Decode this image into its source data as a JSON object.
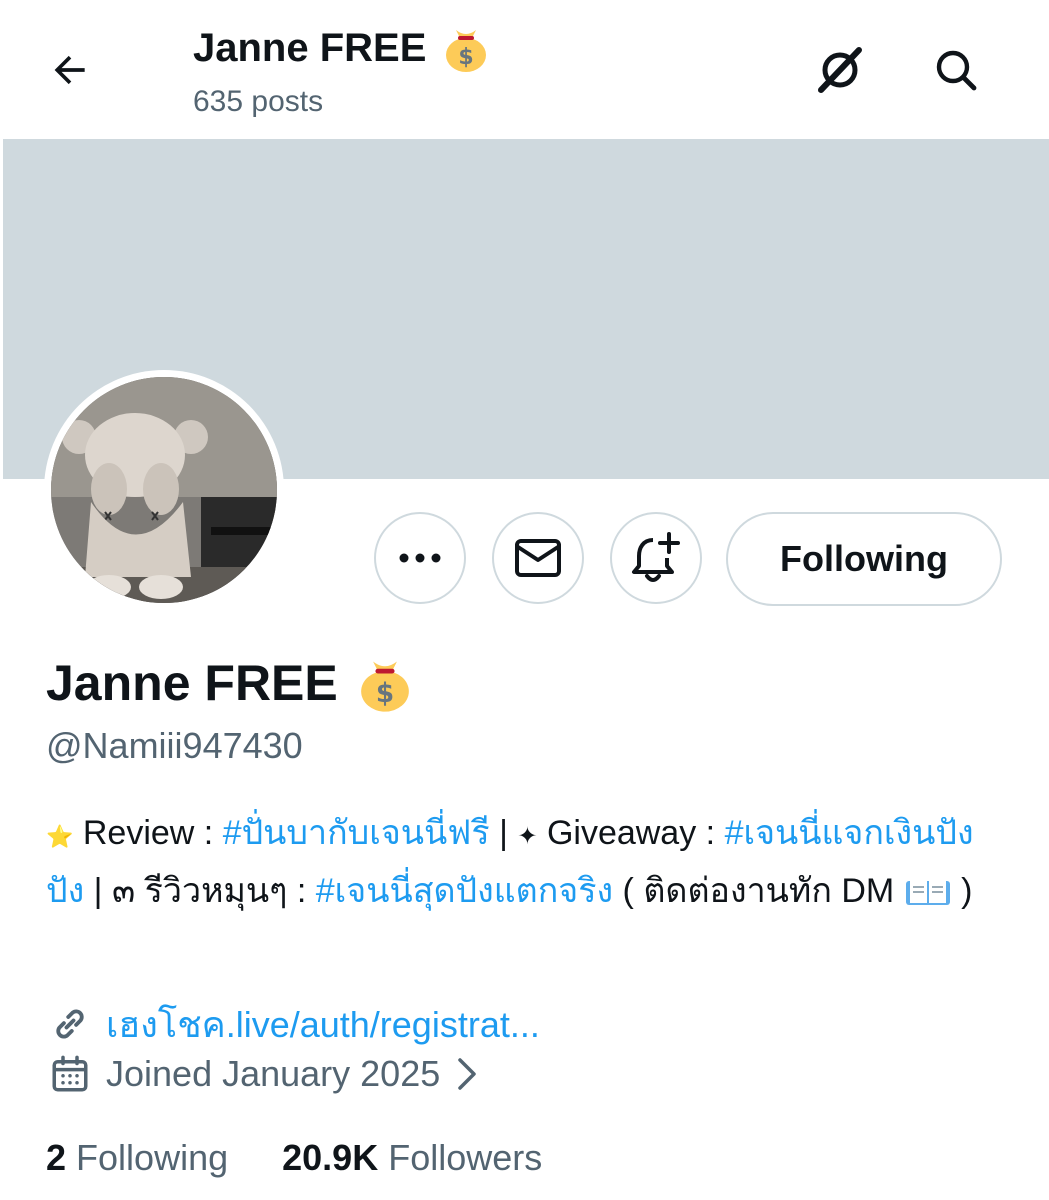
{
  "header": {
    "title": "Janne FREE",
    "title_emoji": "money-bag",
    "posts": "635 posts"
  },
  "profile": {
    "display_name": "Janne FREE",
    "name_emoji": "money-bag",
    "handle": "@Namiii947430",
    "following_button": "Following",
    "bio": {
      "star": "⭐",
      "review_label": "Review :",
      "review_tag": "#ปั่นบากับเจนนี่ฟรี",
      "sep1": "|",
      "sparkle": "✦",
      "giveaway_label": "Giveaway :",
      "giveaway_tag": "#เจนนี่แจกเงินปังปัง",
      "sep2": "|",
      "thai_three": "๓",
      "spin_label": "รีวิวหมุนๆ :",
      "spin_tag": "#เจนนี่สุดปังแตกจริง",
      "contact": "( ติดต่องานทัก DM",
      "book": "📖",
      "close": ")"
    },
    "link": "เฮงโชค.live/auth/registrat...",
    "joined": "Joined January 2025",
    "stats": {
      "following_count": "2",
      "following_label": "Following",
      "followers_count": "20.9K",
      "followers_label": "Followers"
    }
  },
  "icons": {
    "back": "arrow-left-icon",
    "grok": "grok-icon",
    "search": "search-icon",
    "more": "more-icon",
    "message": "mail-icon",
    "notify": "bell-plus-icon",
    "link": "link-icon",
    "calendar": "calendar-icon",
    "chevron": "chevron-right-icon"
  },
  "colors": {
    "accent": "#1d9bf0",
    "banner": "#cfd9de",
    "text": "#0f1419",
    "secondary": "#536471"
  }
}
